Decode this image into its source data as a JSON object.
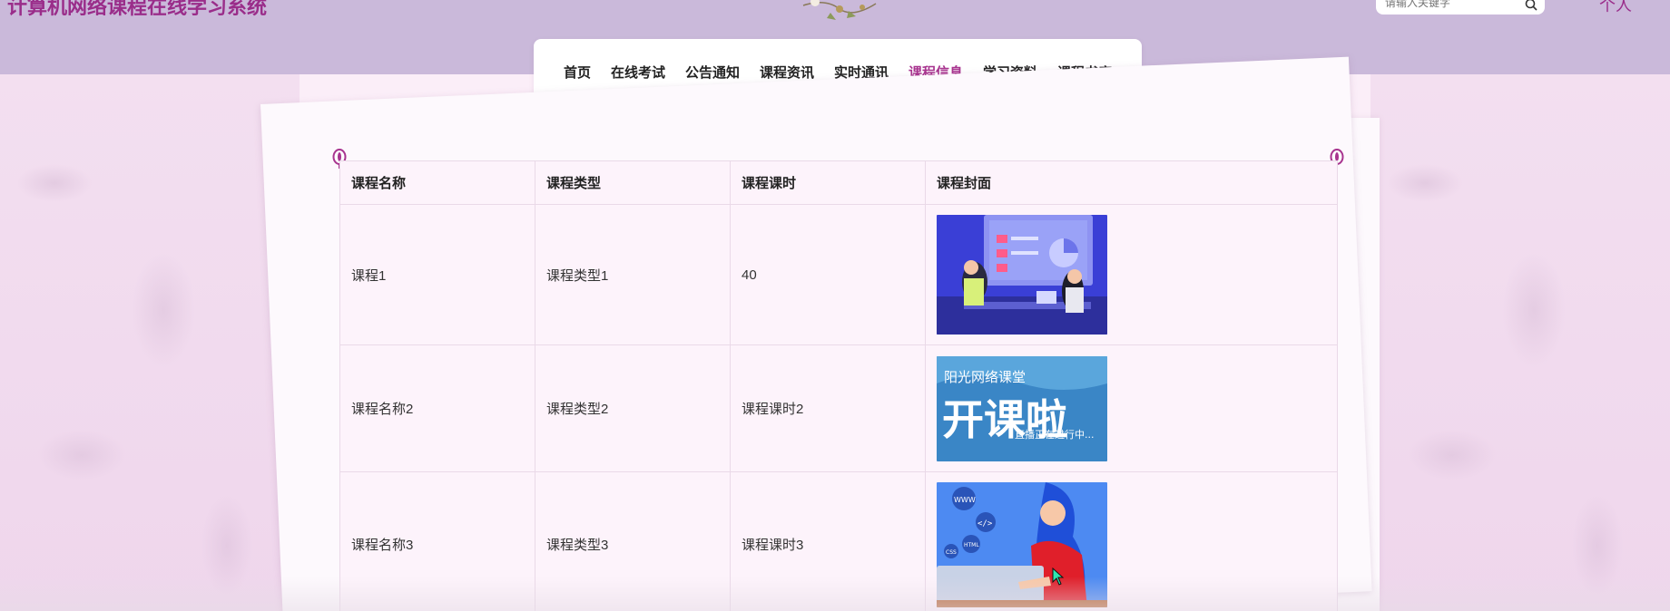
{
  "site": {
    "title": "计算机网络课程在线学习系统",
    "search_placeholder": "请输入关键字",
    "user_label": "个人"
  },
  "nav": {
    "items": [
      {
        "label": "首页",
        "active": false
      },
      {
        "label": "在线考试",
        "active": false
      },
      {
        "label": "公告通知",
        "active": false
      },
      {
        "label": "课程资讯",
        "active": false
      },
      {
        "label": "实时通讯",
        "active": false
      },
      {
        "label": "课程信息",
        "active": true
      },
      {
        "label": "学习资料",
        "active": false
      },
      {
        "label": "课程书库",
        "active": false
      }
    ],
    "accent_color": "#a8348f"
  },
  "table": {
    "headers": [
      "课程名称",
      "课程类型",
      "课程课时",
      "课程封面"
    ],
    "rows": [
      {
        "name": "课程1",
        "type": "课程类型1",
        "hours": "40",
        "cover_icon": "meeting-illustration"
      },
      {
        "name": "课程名称2",
        "type": "课程类型2",
        "hours": "课程课时2",
        "cover_icon": "open-class-banner",
        "cover_text": {
          "line1": "阳光网络课堂",
          "line2": "开课啦",
          "line3": "直播正在进行中..."
        }
      },
      {
        "name": "课程名称3",
        "type": "课程类型3",
        "hours": "课程课时3",
        "cover_icon": "web-developer-illustration",
        "cover_tags": {
          "www": "WWW",
          "code": "</>",
          "html": "HTML",
          "css": "CSS"
        }
      }
    ]
  },
  "colors": {
    "header_band": "#cab9da",
    "title": "#9a2d8a",
    "page_bg": "#f8e9f5"
  }
}
